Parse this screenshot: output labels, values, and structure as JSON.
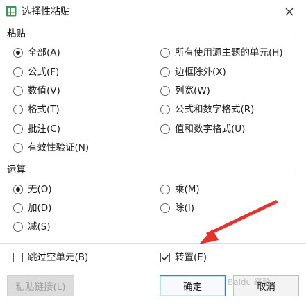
{
  "window": {
    "title": "选择性粘贴"
  },
  "paste": {
    "group_label": "粘贴",
    "options_left": [
      {
        "label": "全部(A)",
        "checked": true
      },
      {
        "label": "公式(F)",
        "checked": false
      },
      {
        "label": "数值(V)",
        "checked": false
      },
      {
        "label": "格式(T)",
        "checked": false
      },
      {
        "label": "批注(C)",
        "checked": false
      },
      {
        "label": "有效性验证(N)",
        "checked": false
      }
    ],
    "options_right": [
      {
        "label": "所有使用源主题的单元(H)",
        "checked": false
      },
      {
        "label": "边框除外(X)",
        "checked": false
      },
      {
        "label": "列宽(W)",
        "checked": false
      },
      {
        "label": "公式和数字格式(R)",
        "checked": false
      },
      {
        "label": "值和数字格式(U)",
        "checked": false
      }
    ]
  },
  "operation": {
    "group_label": "运算",
    "options_left": [
      {
        "label": "无(O)",
        "checked": true
      },
      {
        "label": "加(D)",
        "checked": false
      },
      {
        "label": "减(S)",
        "checked": false
      }
    ],
    "options_right": [
      {
        "label": "乘(M)",
        "checked": false
      },
      {
        "label": "除(I)",
        "checked": false
      }
    ]
  },
  "extra": {
    "skip_blanks": {
      "label": "跳过空单元(B)",
      "checked": false
    },
    "transpose": {
      "label": "转置(E)",
      "checked": true
    }
  },
  "buttons": {
    "paste_link": "粘贴链接(L)",
    "ok": "确定",
    "cancel": "取消"
  },
  "watermark": {
    "text": "Baidu 经验"
  },
  "colors": {
    "arrow": "#e8312a",
    "app_icon": "#2e9e4f",
    "primary_border": "#2f7ee0"
  },
  "icons": {
    "app": "spreadsheet-app-icon",
    "close": "close-icon",
    "annotation": "red-arrow-icon"
  }
}
